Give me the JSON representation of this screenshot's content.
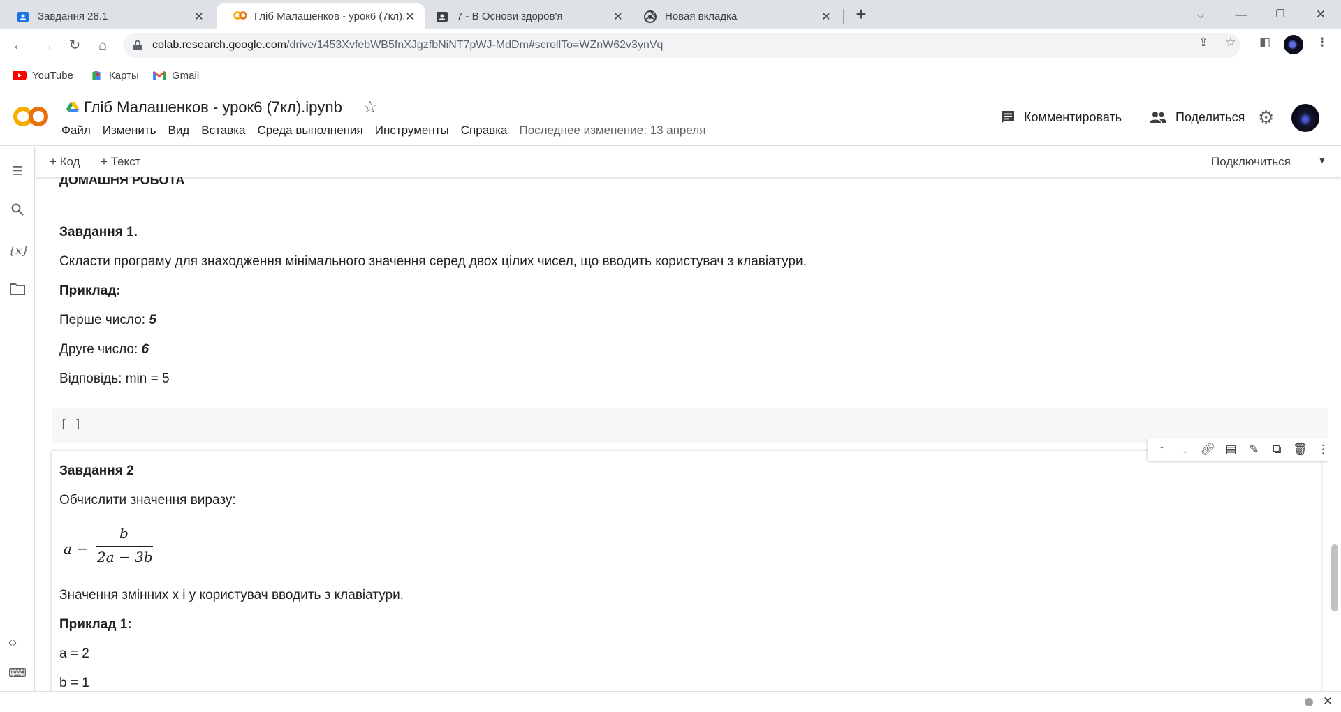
{
  "browser": {
    "tabs": [
      {
        "title": "Завдання 28.1",
        "icon": "classroom-assignment-icon",
        "active": false
      },
      {
        "title": "Гліб Малашенков - урок6 (7кл).ipynb",
        "icon": "colab-icon",
        "active": true
      },
      {
        "title": "7 - В Основи здоров'я",
        "icon": "classroom-icon",
        "active": false
      },
      {
        "title": "Новая вкладка",
        "icon": "chrome-icon",
        "active": false
      }
    ],
    "url_host": "colab.research.google.com",
    "url_path": "/drive/1453XvfebWB5fnXJgzfbNiNT7pWJ-MdDm#scrollTo=WZnW62v3ynVq",
    "bookmarks": [
      {
        "label": "YouTube",
        "icon": "youtube-icon"
      },
      {
        "label": "Карты",
        "icon": "maps-icon"
      },
      {
        "label": "Gmail",
        "icon": "gmail-icon"
      }
    ]
  },
  "colab": {
    "title": "Гліб Малашенков - урок6 (7кл).ipynb",
    "menu": [
      "Файл",
      "Изменить",
      "Вид",
      "Вставка",
      "Среда выполнения",
      "Инструменты",
      "Справка"
    ],
    "last_edit": "Последнее изменение: 13 апреля",
    "comment_label": "Комментировать",
    "share_label": "Поделиться",
    "add_code": "+ Код",
    "add_text": "+ Текст",
    "connect_label": "Подключиться"
  },
  "cells": {
    "homework_heading": "ДОМАШНЯ РОБОТА",
    "task1": {
      "title": "Завдання 1.",
      "desc": "Скласти програму для знаходження мінімального значення серед двох цілих чисел, що вводить користувач з клавіатури.",
      "example_label": "Приклад:",
      "first_label": "Перше число: ",
      "first_value": "5",
      "second_label": "Друге число: ",
      "second_value": "6",
      "answer": "Відповідь: min = 5"
    },
    "code_cell_prompt": "[ ]",
    "task2": {
      "title": "Завдання 2",
      "desc": "Обчислити значення виразу:",
      "formula_lhs": "a −",
      "formula_num": "b",
      "formula_den": "2a − 3b",
      "vars_note": "Значення змінних x і y користувач вводить з клавіатури.",
      "example_label": "Приклад 1:",
      "a_line": "a = 2",
      "b_line": "b = 1"
    }
  }
}
